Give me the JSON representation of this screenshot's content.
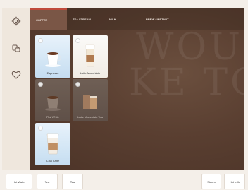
{
  "tabs": [
    {
      "label": "Coffee",
      "active": true
    },
    {
      "label": "Tea Stream",
      "active": false
    },
    {
      "label": "Milk",
      "active": false
    },
    {
      "label": "Brew / Instant",
      "active": false
    }
  ],
  "watermark": {
    "line1": "WOUL",
    "line2": "KE TO"
  },
  "tiles": [
    {
      "name": "Espresso",
      "style": "light"
    },
    {
      "name": "Latte Macchiato",
      "style": "white"
    },
    {
      "name": "Flat White",
      "style": "dim"
    },
    {
      "name": "Latte Macchiato Tea",
      "style": "dim"
    },
    {
      "name": "Chai Latte",
      "style": "light"
    }
  ],
  "sidebar": {
    "icons": [
      "settings-icon",
      "cups-icon",
      "favorite-heart-icon"
    ]
  },
  "bottom": {
    "left_buttons": [
      "Hot Water",
      "Tea",
      "Tea"
    ],
    "right_buttons": [
      "Steam",
      "Hot milk"
    ]
  },
  "colors": {
    "accent": "#c04b3c",
    "background": "#f4efe9",
    "panel": "#5a3f31"
  }
}
